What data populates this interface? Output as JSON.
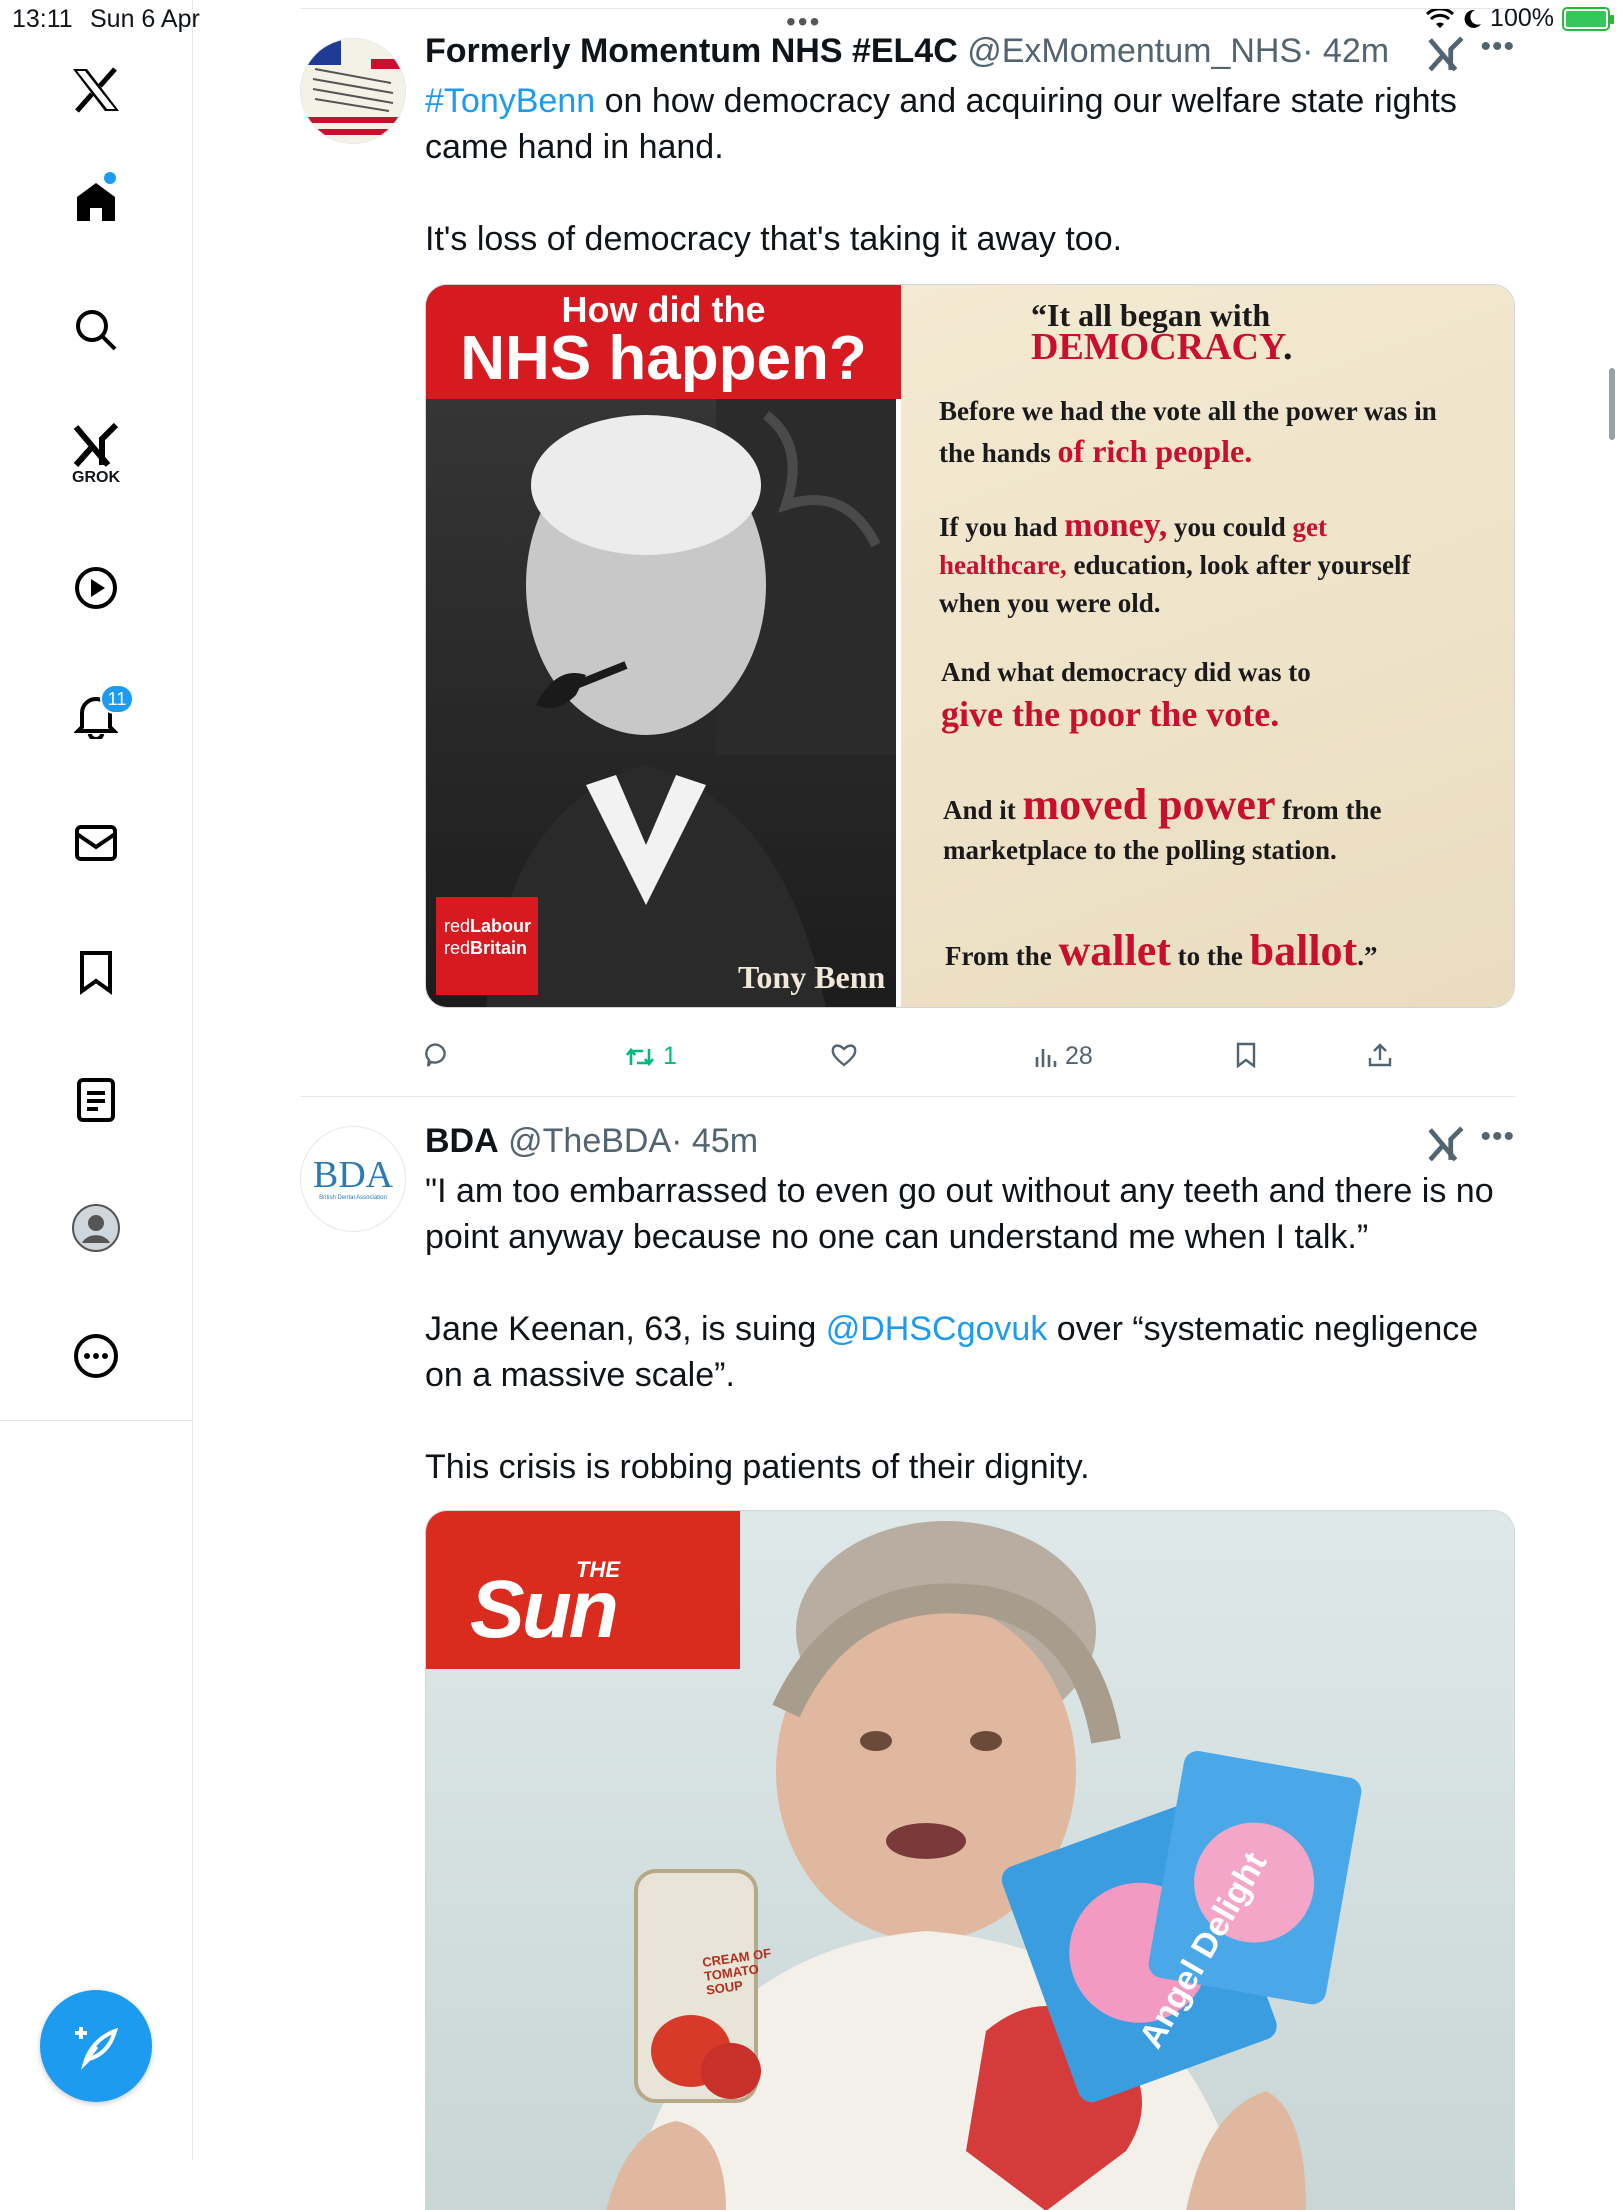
{
  "status_bar": {
    "time": "13:11",
    "date": "Sun 6 Apr",
    "battery": "100%",
    "battery_level": 1.0
  },
  "sidebar": {
    "logo": "x-logo",
    "items": [
      {
        "name": "home",
        "icon": "home-icon"
      },
      {
        "name": "search",
        "icon": "search-icon"
      },
      {
        "name": "grok",
        "icon": "grok-icon",
        "label": "GROK"
      },
      {
        "name": "videos",
        "icon": "play-icon"
      },
      {
        "name": "notifications",
        "icon": "bell-icon",
        "badge": "11"
      },
      {
        "name": "messages",
        "icon": "mail-icon"
      },
      {
        "name": "bookmarks",
        "icon": "bookmark-icon"
      },
      {
        "name": "lists",
        "icon": "list-icon"
      },
      {
        "name": "profile",
        "icon": "profile-icon"
      },
      {
        "name": "more",
        "icon": "more-icon"
      }
    ],
    "compose_icon": "compose-icon"
  },
  "tweets": [
    {
      "author": "Formerly Momentum NHS #EL4C",
      "handle": "@ExMomentum_NHS",
      "time": "· 42m",
      "text_hashtag": "#TonyBenn",
      "text_line1_rest": " on how democracy and acquiring our welfare state rights came hand in hand.",
      "text_para2": "It's loss of democracy that's taking it away too.",
      "image": {
        "banner_line1": "How did the",
        "banner_line2": "NHS happen?",
        "quote_open": "“It all began with",
        "quote_democracy": "DEMOCRACY",
        "quote_p1_a": "Before we had the vote all the power was in the hands",
        "quote_p1_b": "of rich people.",
        "quote_p2_a": "If you had",
        "quote_p2_money": "money,",
        "quote_p2_b": "you could",
        "quote_p2_get": "get healthcare,",
        "quote_p2_c": "education, look after yourself when you were old.",
        "quote_p3_a": "And what democracy did was to",
        "quote_p3_b": "give the poor the vote.",
        "quote_p4_a": "And it",
        "quote_p4_moved": "moved power",
        "quote_p4_b": "from the marketplace to the polling station.",
        "quote_p5_a": "From the",
        "quote_p5_wallet": "wallet",
        "quote_p5_b": "to the",
        "quote_p5_ballot": "ballot",
        "quote_close": ".”",
        "caption": "Tony Benn",
        "logo_line1_a": "red",
        "logo_line1_b": "Labour",
        "logo_line2_a": "red",
        "logo_line2_b": "Britain"
      },
      "actions": {
        "replies": "",
        "reposts": "1",
        "likes": "",
        "views": "28"
      }
    },
    {
      "author": "BDA",
      "handle": "@TheBDA",
      "time": "· 45m",
      "avatar_text": "BDA",
      "avatar_subtext": "British Dental Association",
      "text_para1": "\"I am too embarrassed to even go out without any teeth and there is no point anyway because no one can understand me when I talk.”",
      "text_para2_a": "Jane Keenan, 63, is suing ",
      "text_para2_mention": "@DHSCgovuk",
      "text_para2_b": " over “systematic negligence on a massive scale”.",
      "text_para3": "This crisis is robbing patients of their dignity.",
      "image": {
        "logo_the": "THE",
        "logo_sun": "Sun",
        "can_label": "CREAM OF TOMATO SOUP",
        "packet_label": "Angel Delight"
      }
    }
  ]
}
